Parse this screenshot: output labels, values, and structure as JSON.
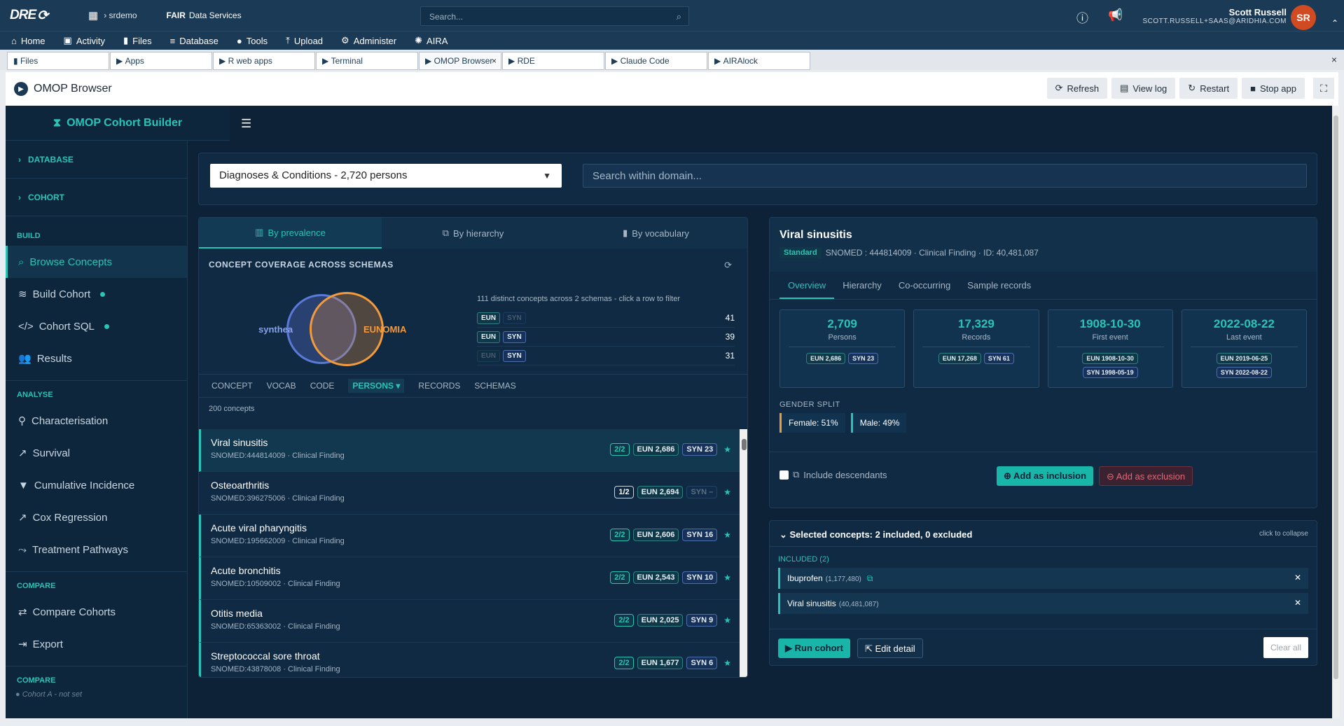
{
  "topbar": {
    "logo": "DRE",
    "breadcrumb": "srdemo",
    "org_bold": "FAIR",
    "org_rest": "Data Services",
    "search_placeholder": "Search...",
    "user_name": "Scott Russell",
    "user_email": "SCOTT.RUSSELL+SAAS@ARIDHIA.COM",
    "avatar_initials": "SR"
  },
  "nav": [
    "Home",
    "Activity",
    "Files",
    "Database",
    "Tools",
    "Upload",
    "Administer",
    "AIRA"
  ],
  "tabs": [
    "Files",
    "Apps",
    "R web apps",
    "Terminal",
    "OMOP Browser",
    "RDE",
    "Claude Code",
    "AIRAlock"
  ],
  "active_tab": "OMOP Browser",
  "app_header": {
    "title": "OMOP Browser",
    "buttons": [
      "Refresh",
      "View log",
      "Restart",
      "Stop app"
    ]
  },
  "sidebar": {
    "brand": "OMOP Cohort Builder",
    "sections": [
      "DATABASE",
      "COHORT"
    ],
    "build_label": "BUILD",
    "build_items": [
      "Browse Concepts",
      "Build Cohort",
      "Cohort SQL",
      "Results"
    ],
    "analyse_label": "ANALYSE",
    "analyse_items": [
      "Characterisation",
      "Survival",
      "Cumulative Incidence",
      "Cox Regression",
      "Treatment Pathways"
    ],
    "compare_label": "COMPARE",
    "compare_items": [
      "Compare Cohorts",
      "Export"
    ],
    "compare2_label": "COMPARE",
    "cohort_a": "Cohort A - not set"
  },
  "filter": {
    "domain": "Diagnoses & Conditions - 2,720 persons",
    "search_placeholder": "Search within domain..."
  },
  "concept_tabs": [
    "By prevalence",
    "By hierarchy",
    "By vocabulary"
  ],
  "coverage": {
    "heading": "CONCEPT COVERAGE ACROSS SCHEMAS",
    "caption": "111 distinct concepts across 2 schemas - click a row to filter",
    "venn_left": "synthea",
    "venn_right": "EUNOMIA",
    "rows": [
      {
        "eun": "EUN",
        "syn": "SYN",
        "value": "41"
      },
      {
        "eun": "EUN",
        "syn": "SYN",
        "value": "39"
      },
      {
        "eun": "EUN",
        "syn": "SYN",
        "value": "31"
      }
    ]
  },
  "columns": [
    "CONCEPT",
    "VOCAB",
    "CODE",
    "PERSONS ▾",
    "RECORDS",
    "SCHEMAS"
  ],
  "concept_count": "200 concepts",
  "concepts": [
    {
      "name": "Viral sinusitis",
      "sub": "SNOMED:444814009 · Clinical Finding",
      "ratio": "2/2",
      "eun": "EUN 2,686",
      "syn": "SYN 23"
    },
    {
      "name": "Osteoarthritis",
      "sub": "SNOMED:396275006 · Clinical Finding",
      "ratio": "1/2",
      "eun": "EUN 2,694",
      "syn": "SYN –"
    },
    {
      "name": "Acute viral pharyngitis",
      "sub": "SNOMED:195662009 · Clinical Finding",
      "ratio": "2/2",
      "eun": "EUN 2,606",
      "syn": "SYN 16"
    },
    {
      "name": "Acute bronchitis",
      "sub": "SNOMED:10509002 · Clinical Finding",
      "ratio": "2/2",
      "eun": "EUN 2,543",
      "syn": "SYN 10"
    },
    {
      "name": "Otitis media",
      "sub": "SNOMED:65363002 · Clinical Finding",
      "ratio": "2/2",
      "eun": "EUN 2,025",
      "syn": "SYN 9"
    },
    {
      "name": "Streptococcal sore throat",
      "sub": "SNOMED:43878008 · Clinical Finding",
      "ratio": "2/2",
      "eun": "EUN 1,677",
      "syn": "SYN 6"
    }
  ],
  "detail": {
    "title": "Viral sinusitis",
    "standard": "Standard",
    "meta": "SNOMED : 444814009 · Clinical Finding · ID: 40,481,087",
    "tabs": [
      "Overview",
      "Hierarchy",
      "Co-occurring",
      "Sample records"
    ],
    "stats": [
      {
        "value": "2,709",
        "label": "Persons",
        "chips": [
          "EUN 2,686",
          "SYN 23"
        ]
      },
      {
        "value": "17,329",
        "label": "Records",
        "chips": [
          "EUN 17,268",
          "SYN 61"
        ]
      },
      {
        "value": "1908-10-30",
        "label": "First event",
        "chips": [
          "EUN 1908-10-30",
          "SYN 1998-05-19"
        ]
      },
      {
        "value": "2022-08-22",
        "label": "Last event",
        "chips": [
          "EUN 2019-06-25",
          "SYN 2022-08-22"
        ]
      }
    ],
    "gender_heading": "GENDER SPLIT",
    "female": "Female: 51%",
    "male": "Male: 49%",
    "include_descendants": "Include descendants",
    "add_inclusion": "Add as inclusion",
    "add_exclusion": "Add as exclusion"
  },
  "selected": {
    "heading": "Selected concepts: 2 included, 0 excluded",
    "collapse": "click to collapse",
    "included_label": "INCLUDED (2)",
    "items": [
      {
        "name": "Ibuprofen",
        "id": "(1,177,480)"
      },
      {
        "name": "Viral sinusitis",
        "id": "(40,481,087)"
      }
    ],
    "run": "Run cohort",
    "edit": "Edit detail",
    "clear": "Clear all"
  }
}
